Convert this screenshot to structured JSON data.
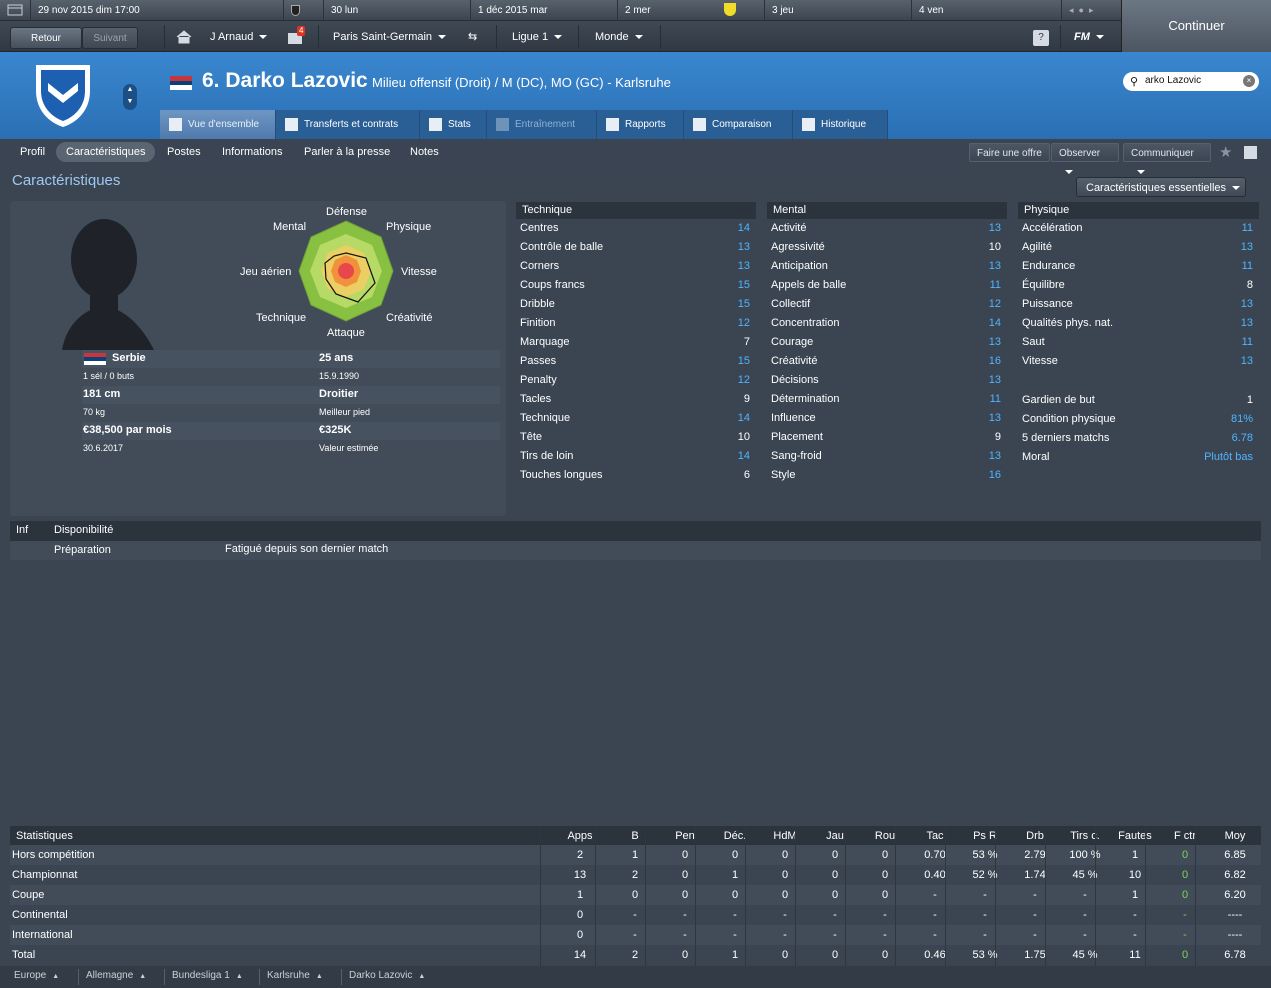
{
  "datebar": {
    "items": [
      "29 nov 2015  dim  17:00",
      "30  lun",
      "1 déc 2015  mar",
      "2  mer",
      "3  jeu",
      "4  ven"
    ]
  },
  "nav": {
    "back": "Retour",
    "forward": "Suivant",
    "manager": "J Arnaud",
    "inbox_count": "4",
    "club": "Paris Saint-Germain",
    "league": "Ligue 1",
    "world": "Monde",
    "fm_logo": "FM",
    "continue": "Continuer"
  },
  "player": {
    "number_name": "6. Darko Lazovic",
    "positions": "Milieu offensif (Droit) / M (DC), MO (GC) - Karlsruhe"
  },
  "search": {
    "value": "arko Lazovic"
  },
  "tabs": [
    "Vue d'ensemble",
    "Transferts et contrats",
    "Stats",
    "Entraînement",
    "Rapports",
    "Comparaison",
    "Historique"
  ],
  "subtabs": [
    "Profil",
    "Caractéristiques",
    "Postes",
    "Informations",
    "Parler à la presse",
    "Notes"
  ],
  "actions": {
    "offer": "Faire une offre",
    "watch": "Observer",
    "communicate": "Communiquer"
  },
  "section_title": "Caractéristiques",
  "view_select": "Caractéristiques essentielles",
  "radar": {
    "top": "Défense",
    "tr": "Physique",
    "r": "Vitesse",
    "br": "Créativité",
    "bottom": "Attaque",
    "bl": "Technique",
    "l": "Jeu aérien",
    "tl": "Mental"
  },
  "info": {
    "nation": "Serbie",
    "caps": "1 sél / 0 buts",
    "height": "181 cm",
    "weight": "70 kg",
    "wage": "€38,500 par mois",
    "contract": "30.6.2017",
    "age": "25 ans",
    "dob": "15.9.1990",
    "foot": "Droitier",
    "foot_label": "Meilleur pied",
    "value": "€325K",
    "value_label": "Valeur estimée"
  },
  "technique": {
    "title": "Technique",
    "rows": [
      [
        "Centres",
        "14",
        1
      ],
      [
        "Contrôle de balle",
        "13",
        1
      ],
      [
        "Corners",
        "13",
        1
      ],
      [
        "Coups francs",
        "15",
        1
      ],
      [
        "Dribble",
        "15",
        1
      ],
      [
        "Finition",
        "12",
        1
      ],
      [
        "Marquage",
        "7",
        0
      ],
      [
        "Passes",
        "15",
        1
      ],
      [
        "Penalty",
        "12",
        1
      ],
      [
        "Tacles",
        "9",
        0
      ],
      [
        "Technique",
        "14",
        1
      ],
      [
        "Tête",
        "10",
        0
      ],
      [
        "Tirs de loin",
        "14",
        1
      ],
      [
        "Touches longues",
        "6",
        0
      ]
    ]
  },
  "mental": {
    "title": "Mental",
    "rows": [
      [
        "Activité",
        "13",
        1
      ],
      [
        "Agressivité",
        "10",
        0
      ],
      [
        "Anticipation",
        "13",
        1
      ],
      [
        "Appels de balle",
        "11",
        1
      ],
      [
        "Collectif",
        "12",
        1
      ],
      [
        "Concentration",
        "14",
        1
      ],
      [
        "Courage",
        "13",
        1
      ],
      [
        "Créativité",
        "16",
        1
      ],
      [
        "Décisions",
        "13",
        1
      ],
      [
        "Détermination",
        "11",
        1
      ],
      [
        "Influence",
        "13",
        1
      ],
      [
        "Placement",
        "9",
        0
      ],
      [
        "Sang-froid",
        "13",
        1
      ],
      [
        "Style",
        "16",
        1
      ]
    ]
  },
  "physique": {
    "title": "Physique",
    "rows": [
      [
        "Accélération",
        "11",
        1
      ],
      [
        "Agilité",
        "13",
        1
      ],
      [
        "Endurance",
        "11",
        1
      ],
      [
        "Équilibre",
        "8",
        0
      ],
      [
        "Puissance",
        "13",
        1
      ],
      [
        "Qualités phys. nat.",
        "13",
        1
      ],
      [
        "Saut",
        "11",
        1
      ],
      [
        "Vitesse",
        "13",
        1
      ]
    ]
  },
  "extra": [
    [
      "Gardien de but",
      "1"
    ],
    [
      "Condition physique",
      "81%"
    ],
    [
      "5 derniers matchs",
      "6.78"
    ],
    [
      "Moral",
      "Plutôt bas"
    ]
  ],
  "availability": {
    "col1": "Inf",
    "col2": "Disponibilité",
    "label": "Préparation",
    "text": "Fatigué depuis son dernier match"
  },
  "stats": {
    "headers": [
      "Statistiques",
      "Apps",
      "B",
      "Pen",
      "Déc.",
      "HdM",
      "Jau",
      "Rou",
      "Tac",
      "Ps R",
      "Drb",
      "Tirs c.",
      "Fautes",
      "F ctr",
      "Moy"
    ],
    "rows": [
      [
        "Hors compétition",
        "2",
        "1",
        "0",
        "0",
        "0",
        "0",
        "0",
        "0.70",
        "53 %",
        "2.79",
        "100 %",
        "1",
        "0",
        "6.85"
      ],
      [
        "Championnat",
        "13",
        "2",
        "0",
        "1",
        "0",
        "0",
        "0",
        "0.40",
        "52 %",
        "1.74",
        "45 %",
        "10",
        "0",
        "6.82"
      ],
      [
        "Coupe",
        "1",
        "0",
        "0",
        "0",
        "0",
        "0",
        "0",
        "-",
        "-",
        "-",
        "-",
        "1",
        "0",
        "6.20"
      ],
      [
        "Continental",
        "0",
        "-",
        "-",
        "-",
        "-",
        "-",
        "-",
        "-",
        "-",
        "-",
        "-",
        "-",
        "-",
        "----"
      ],
      [
        "International",
        "0",
        "-",
        "-",
        "-",
        "-",
        "-",
        "-",
        "-",
        "-",
        "-",
        "-",
        "-",
        "-",
        "----"
      ],
      [
        "Total",
        "14",
        "2",
        "0",
        "1",
        "0",
        "0",
        "0",
        "0.46",
        "53 %",
        "1.75",
        "45 %",
        "11",
        "0",
        "6.78"
      ]
    ]
  },
  "breadcrumb": [
    "Europe",
    "Allemagne",
    "Bundesliga 1",
    "Karlsruhe",
    "Darko Lazovic"
  ],
  "colors": {
    "header_blue": "#2f78c0",
    "highlight": "#4fb4ff",
    "fctr_green": "#7fd35a"
  }
}
